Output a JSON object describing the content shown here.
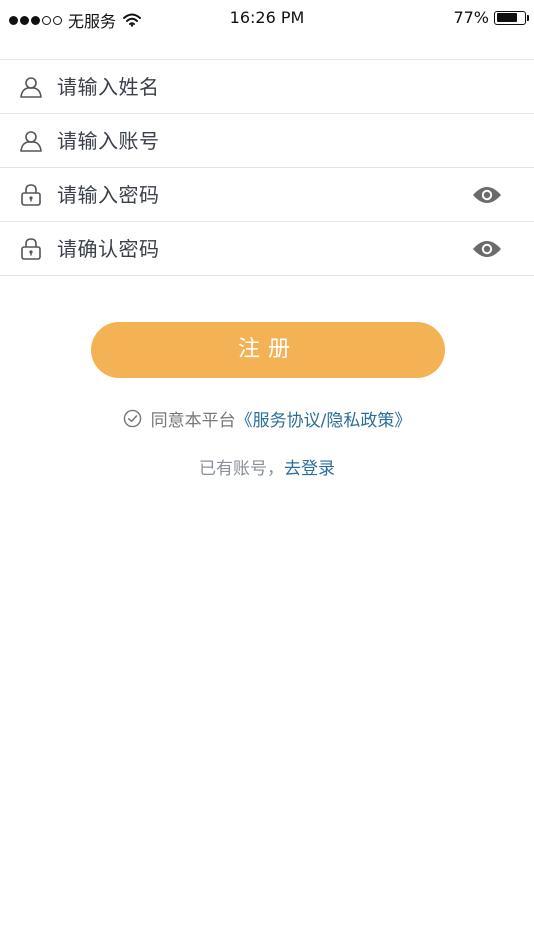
{
  "status_bar": {
    "carrier": "无服务",
    "time": "16:26 PM",
    "battery_text": "77%",
    "battery_level": 0.77
  },
  "form": {
    "name_placeholder": "请输入姓名",
    "account_placeholder": "请输入账号",
    "password_placeholder": "请输入密码",
    "confirm_placeholder": "请确认密码"
  },
  "actions": {
    "register_label": "注册"
  },
  "agreement": {
    "prefix": "同意本平台",
    "link": "《服务协议/隐私政策》"
  },
  "login": {
    "prefix": "已有账号，",
    "link": "去登录"
  },
  "colors": {
    "accent": "#f3b254",
    "link": "#2b6e9a"
  }
}
